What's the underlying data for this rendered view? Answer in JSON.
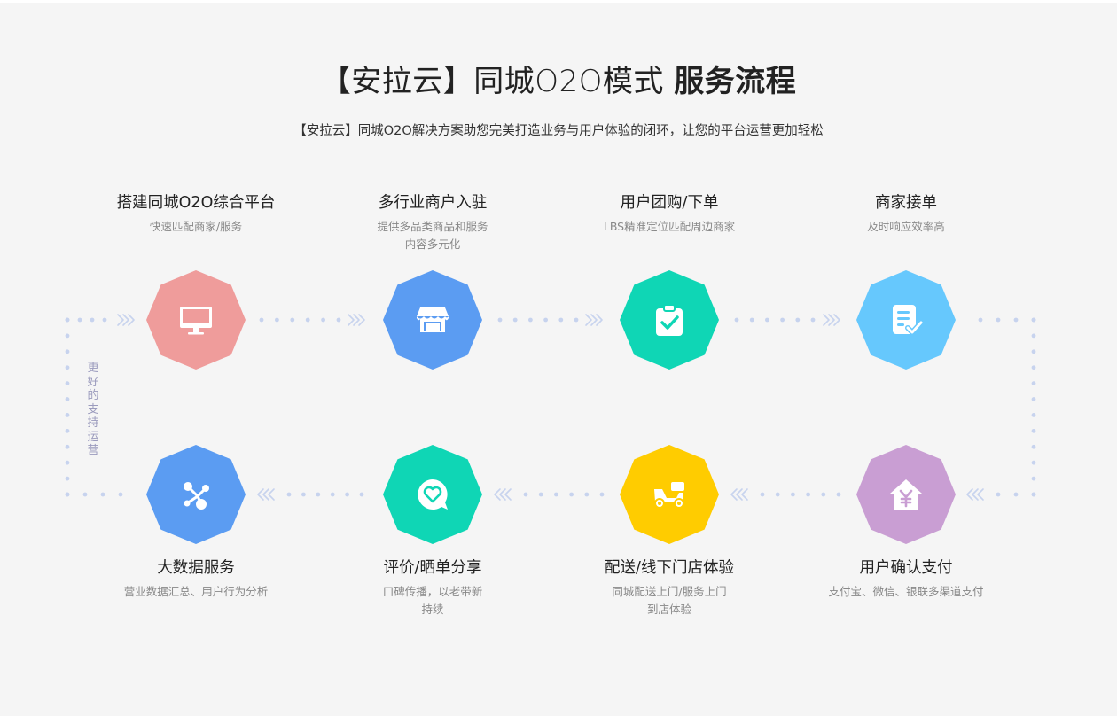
{
  "header": {
    "title_thin": "【安拉云】同城O2O模式",
    "title_bold": "服务流程",
    "subtitle": "【安拉云】同城O2O解决方案助您完美打造业务与用户体验的闭环，让您的平台运营更加轻松"
  },
  "side_label": "更好的支持运营",
  "top_steps": [
    {
      "name": "搭建同城O2O综合平台",
      "desc": "快速匹配商家/服务",
      "color": "#ef9c9b",
      "icon": "monitor-icon"
    },
    {
      "name": "多行业商户入驻",
      "desc": "提供多品类商品和服务\n内容多元化",
      "color": "#5b9cf2",
      "icon": "store-icon"
    },
    {
      "name": "用户团购/下单",
      "desc": "LBS精准定位匹配周边商家",
      "color": "#0fd6b5",
      "icon": "clipboard-check-icon"
    },
    {
      "name": "商家接单",
      "desc": "及时响应效率高",
      "color": "#66c8fd",
      "icon": "document-check-icon"
    }
  ],
  "bottom_steps": [
    {
      "name": "大数据服务",
      "desc": "营业数据汇总、用户行为分析",
      "color": "#5b9cf2",
      "icon": "network-icon"
    },
    {
      "name": "评价/晒单分享",
      "desc": "口碑传播，以老带新\n持续",
      "color": "#0fd6b5",
      "icon": "heart-chat-icon"
    },
    {
      "name": "配送/线下门店体验",
      "desc": "同城配送上门/服务上门\n到店体验",
      "color": "#ffcc00",
      "icon": "scooter-icon"
    },
    {
      "name": "用户确认支付",
      "desc": "支付宝、微信、银联多渠道支付",
      "color": "#c99ed3",
      "icon": "house-yuan-icon"
    }
  ],
  "colors": {
    "dots": "#c7d3ee",
    "background": "#f5f5f5"
  }
}
